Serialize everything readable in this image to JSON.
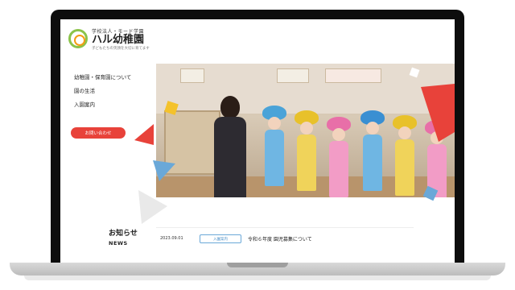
{
  "logo": {
    "org": "学校法人・モード学園",
    "name": "ハル幼稚園",
    "tagline": "子どもたちの笑顔を大切に育てます"
  },
  "nav": {
    "items": [
      {
        "label": "幼稚園・保育園について"
      },
      {
        "label": "園の生活"
      },
      {
        "label": "入園案内"
      }
    ],
    "contact_label": "お問い合わせ"
  },
  "news": {
    "heading": "お知らせ",
    "subheading": "NEWS",
    "items": [
      {
        "date": "2023.09.01",
        "tag": "入園案内",
        "title": "令和６年度 園児募集について"
      }
    ]
  },
  "colors": {
    "accent_red": "#e8423a",
    "accent_blue": "#6aa8d8",
    "accent_yellow": "#f4c22b",
    "accent_green": "#8bc34a"
  }
}
